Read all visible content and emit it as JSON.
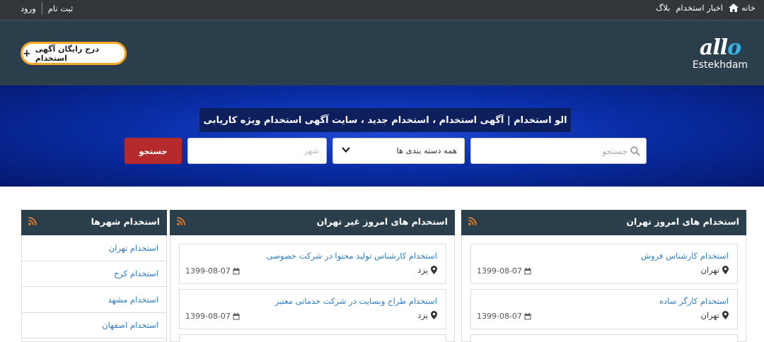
{
  "topbar": {
    "home_label": "خانه",
    "news_label": "اخبار استخدام",
    "blog_label": "بلاگ",
    "register_label": "ثبت نام",
    "login_label": "ورود"
  },
  "header": {
    "post_ad_label": "درج رایگان آگهی استخدام",
    "logo_word": "allo",
    "logo_sub": "Estekhdam"
  },
  "hero": {
    "title": "الو استخدام | آگهی استخدام ، استخدام جدید ، سایت آگهی استخدام ویژه کاریابی",
    "search_placeholder": "جستجو",
    "category_value": "همه دسته بندی ها",
    "city_placeholder": "شهر",
    "search_button": "جستجو"
  },
  "panels": {
    "tehran": {
      "title": "استخدام های امروز تهران",
      "jobs": [
        {
          "title": "استخدام کارشناس فروش",
          "location": "تهران",
          "date": "1399-08-07"
        },
        {
          "title": "استخدام کارگر ساده",
          "location": "تهران",
          "date": "1399-08-07"
        }
      ]
    },
    "non_tehran": {
      "title": "استخدام های امروز غیر تهران",
      "jobs": [
        {
          "title": "استخدام کارشناس تولید محتوا در شرکت خصوصی",
          "location": "یزد",
          "date": "1399-08-07"
        },
        {
          "title": "استخدام طراح وبسایت در شرکت خدماتی معتبر",
          "location": "یزد",
          "date": "1399-08-07"
        }
      ]
    },
    "cities": {
      "title": "استخدام شهرها",
      "items": [
        "استخدام تهران",
        "استخدام کرج",
        "استخدام مشهد",
        "استخدام اصفهان"
      ]
    }
  },
  "colors": {
    "topbar": "#333638",
    "header": "#2b3e4b",
    "accent": "#f6a623",
    "search_button": "#b52a2a",
    "link": "#2c7cc7",
    "rss": "#e8802a"
  }
}
